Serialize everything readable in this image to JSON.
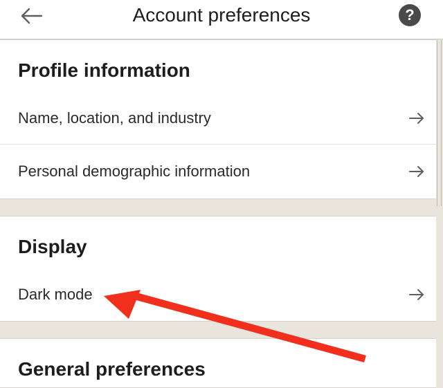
{
  "header": {
    "title": "Account preferences",
    "back_icon": "arrow-left-icon",
    "help_icon": "question-circle-icon",
    "help_glyph": "?"
  },
  "sections": [
    {
      "title": "Profile information",
      "items": [
        {
          "label": "Name, location, and industry",
          "icon": "arrow-right-icon"
        },
        {
          "label": "Personal demographic information",
          "icon": "arrow-right-icon"
        }
      ]
    },
    {
      "title": "Display",
      "items": [
        {
          "label": "Dark mode",
          "icon": "arrow-right-icon"
        }
      ]
    },
    {
      "title": "General preferences",
      "items": []
    }
  ],
  "annotation": {
    "type": "red-arrow",
    "target": "Dark mode",
    "color": "#f0301d"
  },
  "colors": {
    "background": "#e9e5dc",
    "card": "#ffffff",
    "text": "#1d1d1f",
    "icon": "#5e5e5e"
  }
}
